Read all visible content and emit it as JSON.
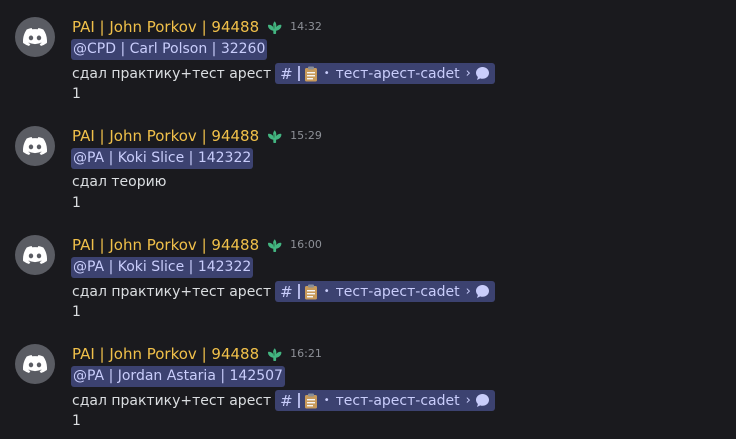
{
  "messages": [
    {
      "username": "PAI | John Porkov | 94488",
      "timestamp": "14:32",
      "mention": "@CPD | Carl Polson | 32260",
      "text": "сдал практику+тест арест",
      "channel": "тест-арест-cadet",
      "number": "1"
    },
    {
      "username": "PAI | John Porkov | 94488",
      "timestamp": "15:29",
      "mention": "@PA | Koki Slice | 142322",
      "text": "сдал теорию",
      "channel": "",
      "number": "1"
    },
    {
      "username": "PAI | John Porkov | 94488",
      "timestamp": "16:00",
      "mention": "@PA | Koki Slice | 142322",
      "text": "сдал практику+тест арест",
      "channel": "тест-арест-cadet",
      "number": "1"
    },
    {
      "username": "PAI | John Porkov | 94488",
      "timestamp": "16:21",
      "mention": "@PA | Jordan Astaria | 142507",
      "text": "сдал практику+тест арест",
      "channel": "тест-арест-cadet",
      "number": "1"
    }
  ],
  "colors": {
    "background": "#1a1a1e",
    "username": "#f0c04a",
    "mention_bg": "#3c4270",
    "mention_text": "#c9cdfb",
    "role_icon": "#43b581"
  },
  "icons": {
    "avatar": "discord-logo-icon",
    "role": "leaf-role-icon",
    "channel_hash": "hash-icon",
    "channel_type": "clipboard-icon",
    "thread": "thread-bubble-icon"
  }
}
